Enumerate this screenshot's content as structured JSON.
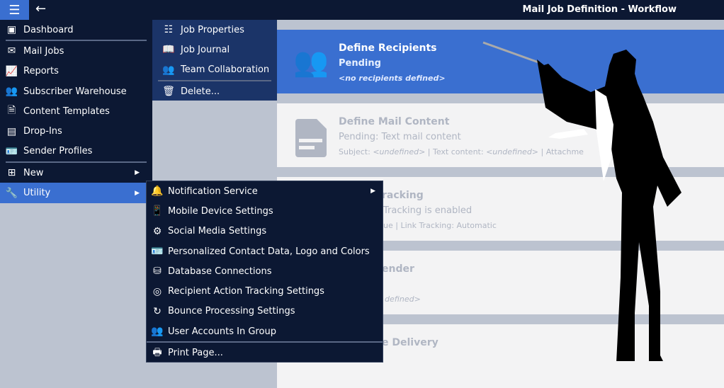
{
  "header": {
    "title": "Mail Job Definition - Workflow"
  },
  "nav": [
    {
      "label": "Dashboard",
      "icon": "dashboard-icon"
    },
    {
      "label": "Mail Jobs",
      "icon": "mail-icon"
    },
    {
      "label": "Reports",
      "icon": "chart-icon"
    },
    {
      "label": "Subscriber Warehouse",
      "icon": "people-icon"
    },
    {
      "label": "Content Templates",
      "icon": "document-icon"
    },
    {
      "label": "Drop-Ins",
      "icon": "inbox-icon"
    },
    {
      "label": "Sender Profiles",
      "icon": "id-card-icon"
    },
    {
      "label": "New",
      "icon": "folder-plus-icon"
    },
    {
      "label": "Utility",
      "icon": "wrench-icon"
    }
  ],
  "job_menu": [
    "Job Properties",
    "Job Journal",
    "Team Collaboration",
    "Delete..."
  ],
  "utility_menu": [
    "Notification Service",
    "Mobile Device Settings",
    "Social Media Settings",
    "Personalized Contact Data, Logo and Colors",
    "Database Connections",
    "Recipient Action Tracking Settings",
    "Bounce Processing Settings",
    "User Accounts In Group",
    "Print Page..."
  ],
  "steps": [
    {
      "title": "Define Recipients",
      "status": "Pending",
      "detail": "<no recipients defined>"
    },
    {
      "title": "Define Mail Content",
      "status": "Pending: Text mail content",
      "detail_parts": [
        "Subject: ",
        "<undefined>",
        " | Text content: ",
        "<undefined>",
        " | Attachme"
      ]
    },
    {
      "title": "racking",
      "status": "Tracking is enabled",
      "detail": "ue | Link Tracking: Automatic"
    },
    {
      "title": "ender",
      "status": "",
      "detail": "defined>"
    },
    {
      "title": "e Delivery"
    }
  ]
}
